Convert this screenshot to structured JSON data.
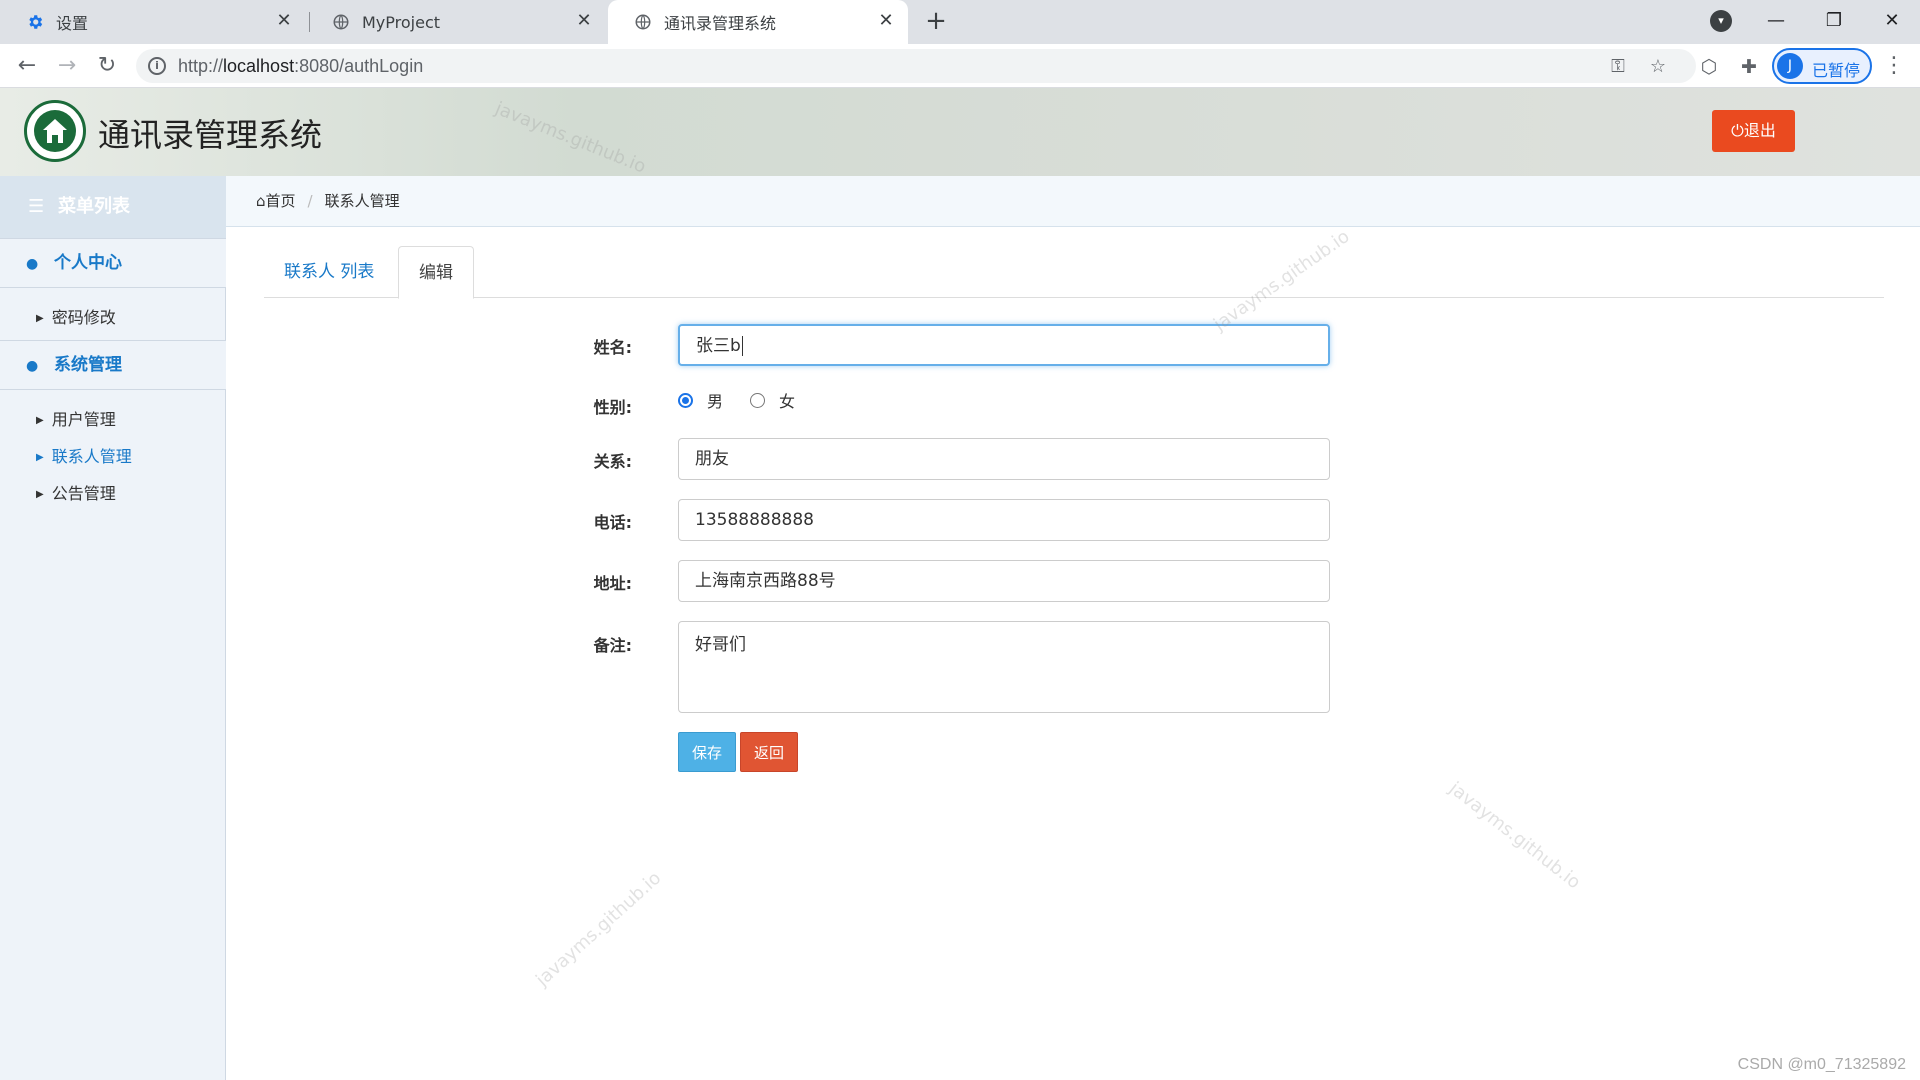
{
  "browser": {
    "tabs": [
      {
        "title": "设置",
        "icon": "gear-icon"
      },
      {
        "title": "MyProject",
        "icon": "globe-icon"
      },
      {
        "title": "通讯录管理系统",
        "icon": "globe-icon"
      }
    ],
    "url_prefix": "http://",
    "url_host": "localhost",
    "url_rest": ":8080/authLogin",
    "profile_initial": "J",
    "profile_label": "已暂停"
  },
  "app": {
    "title": "通讯录管理系统",
    "logout_label": "退出"
  },
  "sidebar": {
    "title": "菜单列表",
    "groups": [
      {
        "label": "个人中心",
        "items": [
          {
            "label": "密码修改"
          }
        ]
      },
      {
        "label": "系统管理",
        "items": [
          {
            "label": "用户管理"
          },
          {
            "label": "联系人管理",
            "active": true
          },
          {
            "label": "公告管理"
          }
        ]
      }
    ]
  },
  "breadcrumb": {
    "home": "首页",
    "current": "联系人管理"
  },
  "tabs": {
    "list": "联系人 列表",
    "edit": "编辑"
  },
  "form": {
    "name_label": "姓名:",
    "name_value": "张三b",
    "gender_label": "性别:",
    "gender_male": "男",
    "gender_female": "女",
    "gender_selected": "男",
    "relation_label": "关系:",
    "relation_value": "朋友",
    "phone_label": "电话:",
    "phone_value": "13588888888",
    "address_label": "地址:",
    "address_value": "上海南京西路88号",
    "note_label": "备注:",
    "note_value": "好哥们",
    "save_label": "保存",
    "back_label": "返回"
  },
  "watermark": "javayms.github.io",
  "credit": "CSDN @m0_71325892"
}
